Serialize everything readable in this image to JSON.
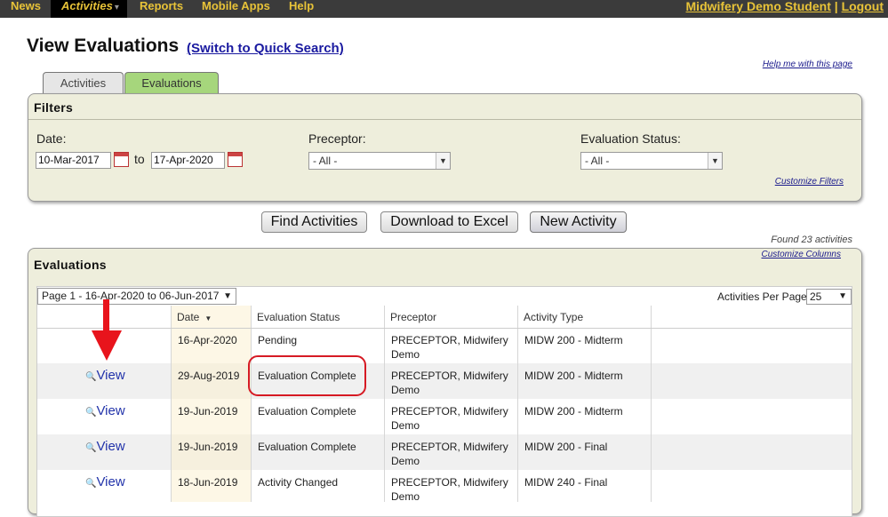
{
  "nav": {
    "items": [
      "News",
      "Activities",
      "Reports",
      "Mobile Apps",
      "Help"
    ],
    "active_caret": "▾",
    "user_name": "Midwifery Demo Student",
    "separator": "|",
    "logout": "Logout"
  },
  "page": {
    "title": "View Evaluations",
    "quick_search": "(Switch to Quick Search)",
    "help_link": "Help me with this page"
  },
  "tabs": [
    "Activities",
    "Evaluations"
  ],
  "filters": {
    "title": "Filters",
    "date_label": "Date:",
    "date_from": "10-Mar-2017",
    "to_label": "to",
    "date_to": "17-Apr-2020",
    "preceptor_label": "Preceptor:",
    "preceptor_value": "- All -",
    "status_label": "Evaluation Status:",
    "status_value": "- All -",
    "customize_filters": "Customize Filters"
  },
  "actions": {
    "find": "Find Activities",
    "download": "Download to Excel",
    "new": "New Activity"
  },
  "evaluations": {
    "found": "Found 23 activities",
    "customize_columns": "Customize Columns",
    "title": "Evaluations",
    "pager": "Page 1 - 16-Apr-2020 to 06-Jun-2017",
    "per_page_label": "Activities Per Page:",
    "per_page": "25",
    "columns": [
      "Date",
      "Evaluation Status",
      "Preceptor",
      "Activity Type"
    ],
    "sort_indicator": "▼",
    "view_label": "View",
    "rows": [
      {
        "view": "",
        "date": "16-Apr-2020",
        "status": "Pending",
        "preceptor": "PRECEPTOR, Midwifery Demo",
        "type": "MIDW 200 - Midterm"
      },
      {
        "view": "View",
        "date": "29-Aug-2019",
        "status": "Evaluation Complete",
        "preceptor": "PRECEPTOR, Midwifery Demo",
        "type": "MIDW 200 - Midterm"
      },
      {
        "view": "View",
        "date": "19-Jun-2019",
        "status": "Evaluation Complete",
        "preceptor": "PRECEPTOR, Midwifery Demo",
        "type": "MIDW 200 - Midterm"
      },
      {
        "view": "View",
        "date": "19-Jun-2019",
        "status": "Evaluation Complete",
        "preceptor": "PRECEPTOR, Midwifery Demo",
        "type": "MIDW 200 - Final"
      },
      {
        "view": "View",
        "date": "18-Jun-2019",
        "status": "Activity Changed",
        "preceptor": "PRECEPTOR, Midwifery Demo",
        "type": "MIDW 240 - Final"
      }
    ]
  },
  "colors": {
    "nav_bg": "#3b3b3b",
    "nav_text": "#e8c338",
    "panel_bg": "#eeeedc",
    "active_tab": "#a6d67c",
    "annotation": "#e8141c"
  }
}
